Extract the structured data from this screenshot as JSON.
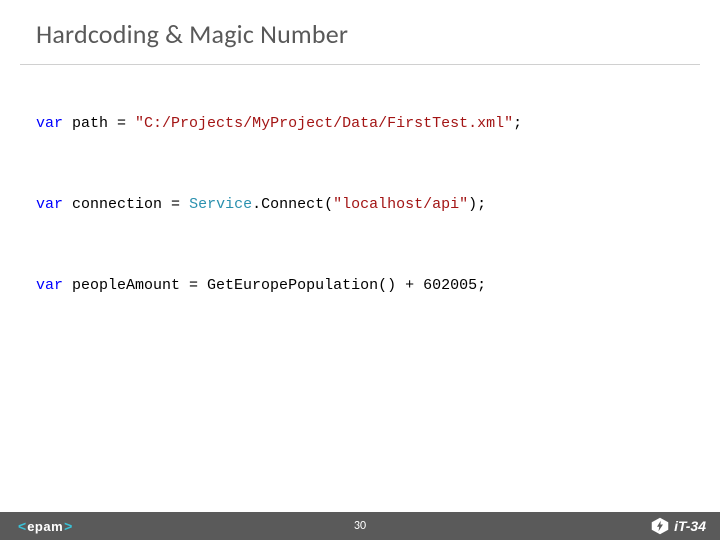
{
  "meta": {
    "title": "Hardcoding & Magic Number",
    "page_number": "30"
  },
  "branding": {
    "angle_open": "<",
    "company": "epam",
    "angle_close": ">",
    "event": "iT-34"
  },
  "code": {
    "line1": {
      "kw": "var",
      "id": " path ",
      "op1": "= ",
      "str": "\"C:/Projects/MyProject/Data/FirstTest.xml\"",
      "op2": ";"
    },
    "line2": {
      "kw": "var",
      "id": " connection ",
      "op1": "= ",
      "type": "Service",
      "op2": ".Connect(",
      "str": "\"localhost/api\"",
      "op3": ");"
    },
    "line3": {
      "kw": "var",
      "id": " peopleAmount ",
      "op1": "= GetEuropePopulation() + ",
      "num": "602005",
      "op2": ";"
    }
  }
}
